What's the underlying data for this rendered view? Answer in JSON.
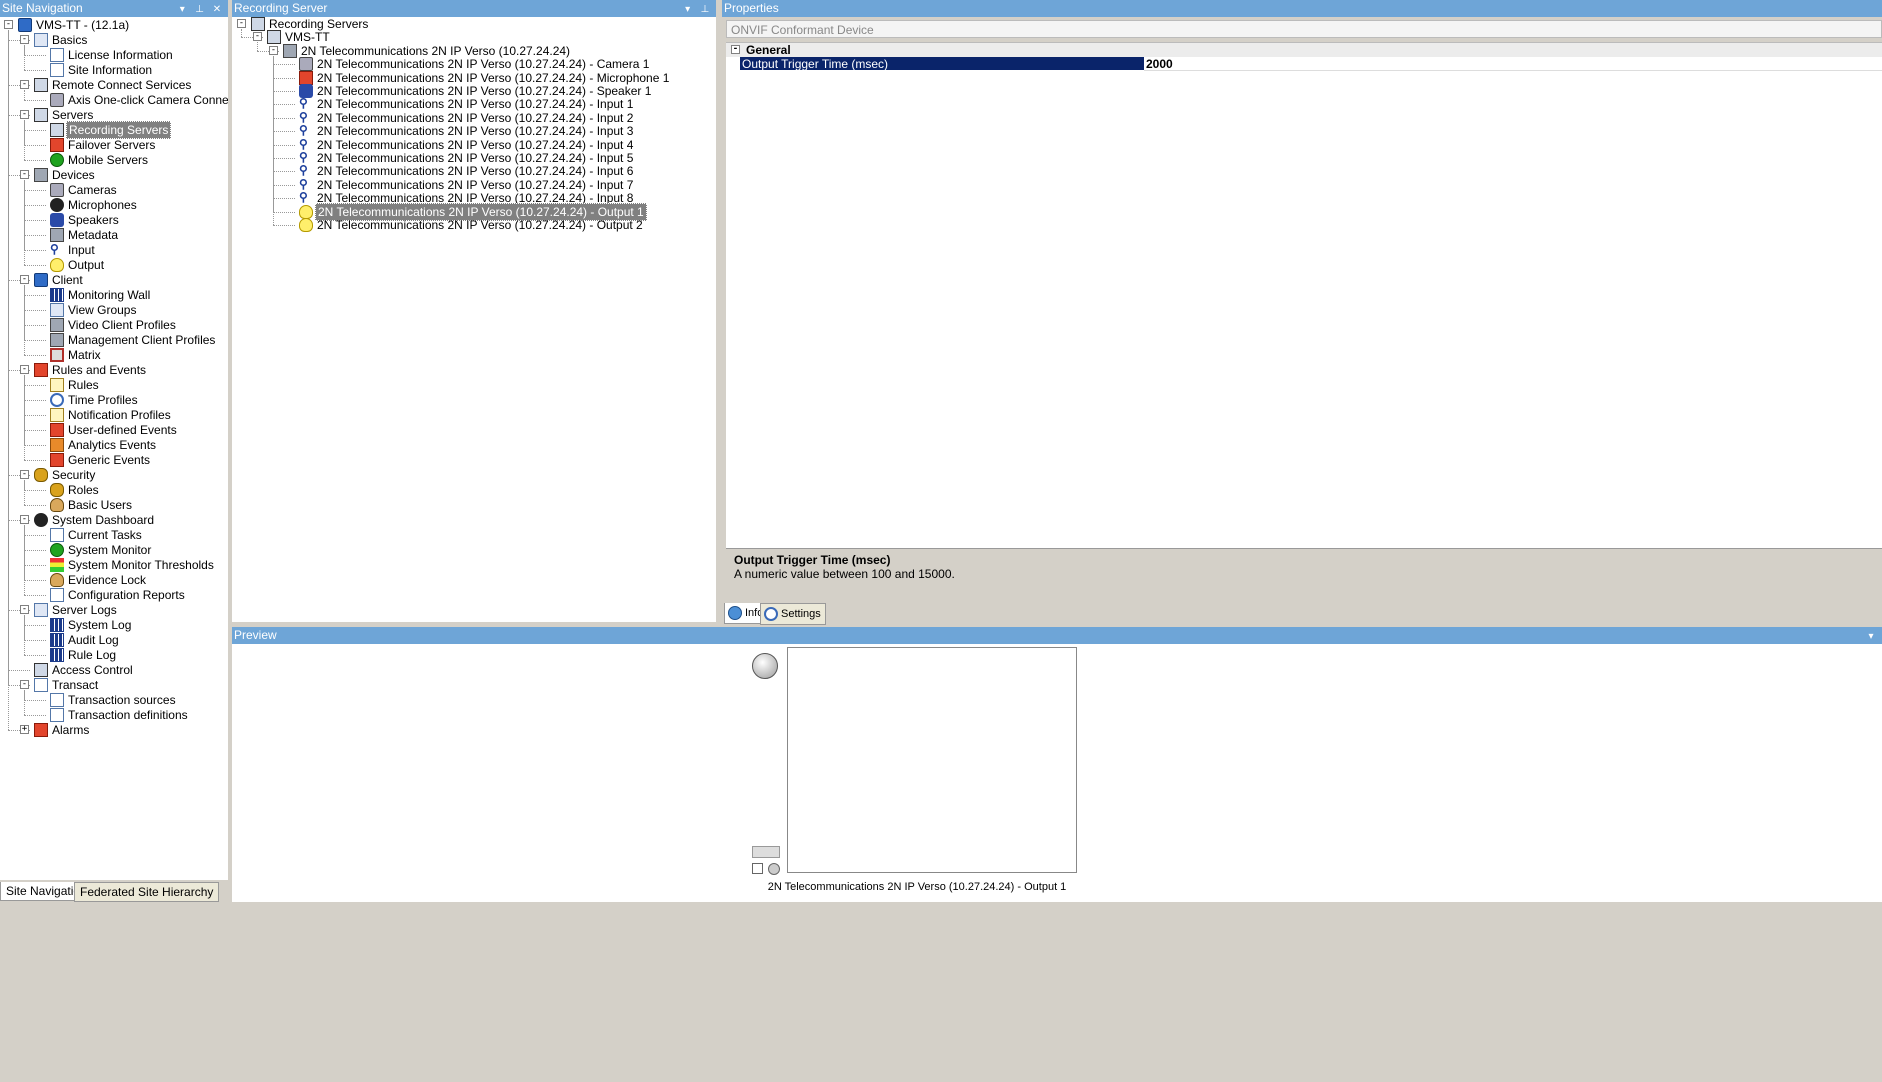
{
  "site_nav": {
    "title": "Site Navigation",
    "items": [
      {
        "label": "VMS-TT - (12.1a)",
        "lvl": 0,
        "exp": "-",
        "icon": "vms-icon",
        "cls": "i-vms"
      },
      {
        "label": "Basics",
        "lvl": 1,
        "exp": "-",
        "icon": "book-icon",
        "cls": "i-folder"
      },
      {
        "label": "License Information",
        "lvl": 2,
        "icon": "license-icon",
        "cls": "i-doc"
      },
      {
        "label": "Site Information",
        "lvl": 2,
        "icon": "site-info-icon",
        "cls": "i-doc"
      },
      {
        "label": "Remote Connect Services",
        "lvl": 1,
        "exp": "-",
        "icon": "remote-connect-icon",
        "cls": "i-server"
      },
      {
        "label": "Axis One-click Camera Connection",
        "lvl": 2,
        "icon": "axis-camera-icon",
        "cls": "i-cam"
      },
      {
        "label": "Servers",
        "lvl": 1,
        "exp": "-",
        "icon": "servers-icon",
        "cls": "i-server"
      },
      {
        "label": "Recording Servers",
        "lvl": 2,
        "icon": "recording-server-icon",
        "cls": "i-server",
        "selected": true
      },
      {
        "label": "Failover Servers",
        "lvl": 2,
        "icon": "failover-server-icon",
        "cls": "i-red"
      },
      {
        "label": "Mobile Servers",
        "lvl": 2,
        "icon": "mobile-server-icon",
        "cls": "i-green"
      },
      {
        "label": "Devices",
        "lvl": 1,
        "exp": "-",
        "icon": "devices-icon",
        "cls": "i-dev"
      },
      {
        "label": "Cameras",
        "lvl": 2,
        "icon": "camera-icon",
        "cls": "i-cam"
      },
      {
        "label": "Microphones",
        "lvl": 2,
        "icon": "microphone-icon",
        "cls": "i-black"
      },
      {
        "label": "Speakers",
        "lvl": 2,
        "icon": "speaker-icon",
        "cls": "i-speaker"
      },
      {
        "label": "Metadata",
        "lvl": 2,
        "icon": "metadata-icon",
        "cls": "i-dev"
      },
      {
        "label": "Input",
        "lvl": 2,
        "icon": "input-icon",
        "cls": "i-input"
      },
      {
        "label": "Output",
        "lvl": 2,
        "icon": "output-bulb-icon",
        "cls": "i-bulb"
      },
      {
        "label": "Client",
        "lvl": 1,
        "exp": "-",
        "icon": "client-icon",
        "cls": "i-vms"
      },
      {
        "label": "Monitoring Wall",
        "lvl": 2,
        "icon": "monitoring-wall-icon",
        "cls": "i-grid"
      },
      {
        "label": "View Groups",
        "lvl": 2,
        "icon": "view-groups-icon",
        "cls": "i-folder"
      },
      {
        "label": "Video Client Profiles",
        "lvl": 2,
        "icon": "video-client-profile-icon",
        "cls": "i-dev"
      },
      {
        "label": "Management Client Profiles",
        "lvl": 2,
        "icon": "management-client-profile-icon",
        "cls": "i-dev"
      },
      {
        "label": "Matrix",
        "lvl": 2,
        "icon": "matrix-icon",
        "cls": "i-matrix"
      },
      {
        "label": "Rules and Events",
        "lvl": 1,
        "exp": "-",
        "icon": "rules-events-icon",
        "cls": "i-red"
      },
      {
        "label": "Rules",
        "lvl": 2,
        "icon": "rules-icon",
        "cls": "i-mail"
      },
      {
        "label": "Time Profiles",
        "lvl": 2,
        "icon": "clock-icon",
        "cls": "i-clock"
      },
      {
        "label": "Notification Profiles",
        "lvl": 2,
        "icon": "mail-icon",
        "cls": "i-mail"
      },
      {
        "label": "User-defined Events",
        "lvl": 2,
        "icon": "user-event-icon",
        "cls": "i-red"
      },
      {
        "label": "Analytics Events",
        "lvl": 2,
        "icon": "analytics-event-icon",
        "cls": "i-flag"
      },
      {
        "label": "Generic Events",
        "lvl": 2,
        "icon": "generic-event-icon",
        "cls": "i-red"
      },
      {
        "label": "Security",
        "lvl": 1,
        "exp": "-",
        "icon": "security-icon",
        "cls": "i-key"
      },
      {
        "label": "Roles",
        "lvl": 2,
        "icon": "roles-icon",
        "cls": "i-key"
      },
      {
        "label": "Basic Users",
        "lvl": 2,
        "icon": "basic-user-icon",
        "cls": "i-user"
      },
      {
        "label": "System Dashboard",
        "lvl": 1,
        "exp": "-",
        "icon": "dashboard-icon",
        "cls": "i-black"
      },
      {
        "label": "Current Tasks",
        "lvl": 2,
        "icon": "tasks-icon",
        "cls": "i-doc"
      },
      {
        "label": "System Monitor",
        "lvl": 2,
        "icon": "system-monitor-icon",
        "cls": "i-green"
      },
      {
        "label": "System Monitor Thresholds",
        "lvl": 2,
        "icon": "thresholds-icon",
        "cls": "i-bars"
      },
      {
        "label": "Evidence Lock",
        "lvl": 2,
        "icon": "evidence-lock-icon",
        "cls": "i-user"
      },
      {
        "label": "Configuration Reports",
        "lvl": 2,
        "icon": "report-icon",
        "cls": "i-doc"
      },
      {
        "label": "Server Logs",
        "lvl": 1,
        "exp": "-",
        "icon": "server-logs-icon",
        "cls": "i-folder"
      },
      {
        "label": "System Log",
        "lvl": 2,
        "icon": "log-icon",
        "cls": "i-grid"
      },
      {
        "label": "Audit Log",
        "lvl": 2,
        "icon": "log-icon",
        "cls": "i-grid"
      },
      {
        "label": "Rule Log",
        "lvl": 2,
        "icon": "log-icon",
        "cls": "i-grid"
      },
      {
        "label": "Access Control",
        "lvl": 1,
        "icon": "access-control-icon",
        "cls": "i-server"
      },
      {
        "label": "Transact",
        "lvl": 1,
        "exp": "-",
        "icon": "transact-icon",
        "cls": "i-doc"
      },
      {
        "label": "Transaction sources",
        "lvl": 2,
        "icon": "transaction-source-icon",
        "cls": "i-doc"
      },
      {
        "label": "Transaction definitions",
        "lvl": 2,
        "icon": "transaction-definition-icon",
        "cls": "i-doc"
      },
      {
        "label": "Alarms",
        "lvl": 1,
        "exp": "+",
        "icon": "alarm-icon",
        "cls": "i-red"
      }
    ],
    "tabs": [
      "Site Navigation",
      "Federated Site Hierarchy"
    ]
  },
  "recording": {
    "title": "Recording Server",
    "items": [
      {
        "label": "Recording Servers",
        "lvl": 0,
        "exp": "-",
        "icon": "recording-servers-icon",
        "cls": "i-server"
      },
      {
        "label": "VMS-TT",
        "lvl": 1,
        "exp": "-",
        "icon": "server-icon",
        "cls": "i-server"
      },
      {
        "label": "2N Telecommunications 2N IP Verso (10.27.24.24)",
        "lvl": 2,
        "exp": "-",
        "icon": "hardware-device-icon",
        "cls": "i-dev"
      },
      {
        "label": "2N Telecommunications 2N IP Verso (10.27.24.24) - Camera 1",
        "lvl": 3,
        "icon": "camera-icon",
        "cls": "i-cam"
      },
      {
        "label": "2N Telecommunications 2N IP Verso (10.27.24.24) - Microphone 1",
        "lvl": 3,
        "icon": "microphone-icon",
        "cls": "i-red"
      },
      {
        "label": "2N Telecommunications 2N IP Verso (10.27.24.24) - Speaker 1",
        "lvl": 3,
        "icon": "speaker-icon",
        "cls": "i-speaker"
      },
      {
        "label": "2N Telecommunications 2N IP Verso (10.27.24.24) - Input 1",
        "lvl": 3,
        "icon": "input-icon",
        "cls": "i-input"
      },
      {
        "label": "2N Telecommunications 2N IP Verso (10.27.24.24) - Input 2",
        "lvl": 3,
        "icon": "input-icon",
        "cls": "i-input"
      },
      {
        "label": "2N Telecommunications 2N IP Verso (10.27.24.24) - Input 3",
        "lvl": 3,
        "icon": "input-icon",
        "cls": "i-input"
      },
      {
        "label": "2N Telecommunications 2N IP Verso (10.27.24.24) - Input 4",
        "lvl": 3,
        "icon": "input-icon",
        "cls": "i-input"
      },
      {
        "label": "2N Telecommunications 2N IP Verso (10.27.24.24) - Input 5",
        "lvl": 3,
        "icon": "input-icon",
        "cls": "i-input"
      },
      {
        "label": "2N Telecommunications 2N IP Verso (10.27.24.24) - Input 6",
        "lvl": 3,
        "icon": "input-icon",
        "cls": "i-input"
      },
      {
        "label": "2N Telecommunications 2N IP Verso (10.27.24.24) - Input 7",
        "lvl": 3,
        "icon": "input-icon",
        "cls": "i-input"
      },
      {
        "label": "2N Telecommunications 2N IP Verso (10.27.24.24) - Input 8",
        "lvl": 3,
        "icon": "input-icon",
        "cls": "i-input"
      },
      {
        "label": "2N Telecommunications 2N IP Verso (10.27.24.24) - Output 1",
        "lvl": 3,
        "icon": "output-bulb-icon",
        "cls": "i-bulb",
        "selected": true
      },
      {
        "label": "2N Telecommunications 2N IP Verso (10.27.24.24) - Output 2",
        "lvl": 3,
        "icon": "output-bulb-icon",
        "cls": "i-bulb"
      }
    ]
  },
  "properties": {
    "title": "Properties",
    "device_type": "ONVIF Conformant Device",
    "category": "General",
    "property_name": "Output Trigger Time (msec)",
    "property_value": "2000",
    "help_title": "Output Trigger Time (msec)",
    "help_text": "A numeric value between 100 and 15000.",
    "tab_info": "Info",
    "tab_settings": "Settings"
  },
  "preview": {
    "title": "Preview",
    "caption": "2N Telecommunications 2N IP Verso (10.27.24.24) - Output 1"
  },
  "pane_controls": {
    "dropdown": "▾",
    "pin": "⊥",
    "close": "✕"
  }
}
